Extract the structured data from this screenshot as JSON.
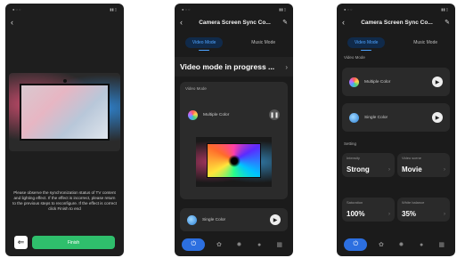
{
  "phone1": {
    "instructions": "Please observe the synchronization status of TV content and lighting effect. If the effect is incorrect, please return to the previous steps to reconfigure. If the effect is correct click Finish to end",
    "finish_label": "Finish",
    "back_icon": "arrow-left-icon"
  },
  "phone2": {
    "title": "Camera Screen Sync Co...",
    "tabs": [
      "Video Mode",
      "Music Mode"
    ],
    "banner": "Video mode in progress ...",
    "section_label": "Video Mode",
    "options": [
      {
        "label": "Multiple Color"
      },
      {
        "label": "Single Color"
      }
    ]
  },
  "phone3": {
    "title": "Camera Screen Sync Co...",
    "tabs": [
      "Video Mode",
      "Music Mode"
    ],
    "section_label": "Video Mode",
    "options": [
      {
        "label": "Multiple Color"
      },
      {
        "label": "Single Color"
      }
    ],
    "setting_label": "Setting",
    "stats": [
      {
        "key": "Intensity",
        "value": "Strong"
      },
      {
        "key": "Video scene",
        "value": "Movie"
      },
      {
        "key": "Saturation",
        "value": "100%"
      },
      {
        "key": "White balance",
        "value": "35%"
      }
    ]
  }
}
